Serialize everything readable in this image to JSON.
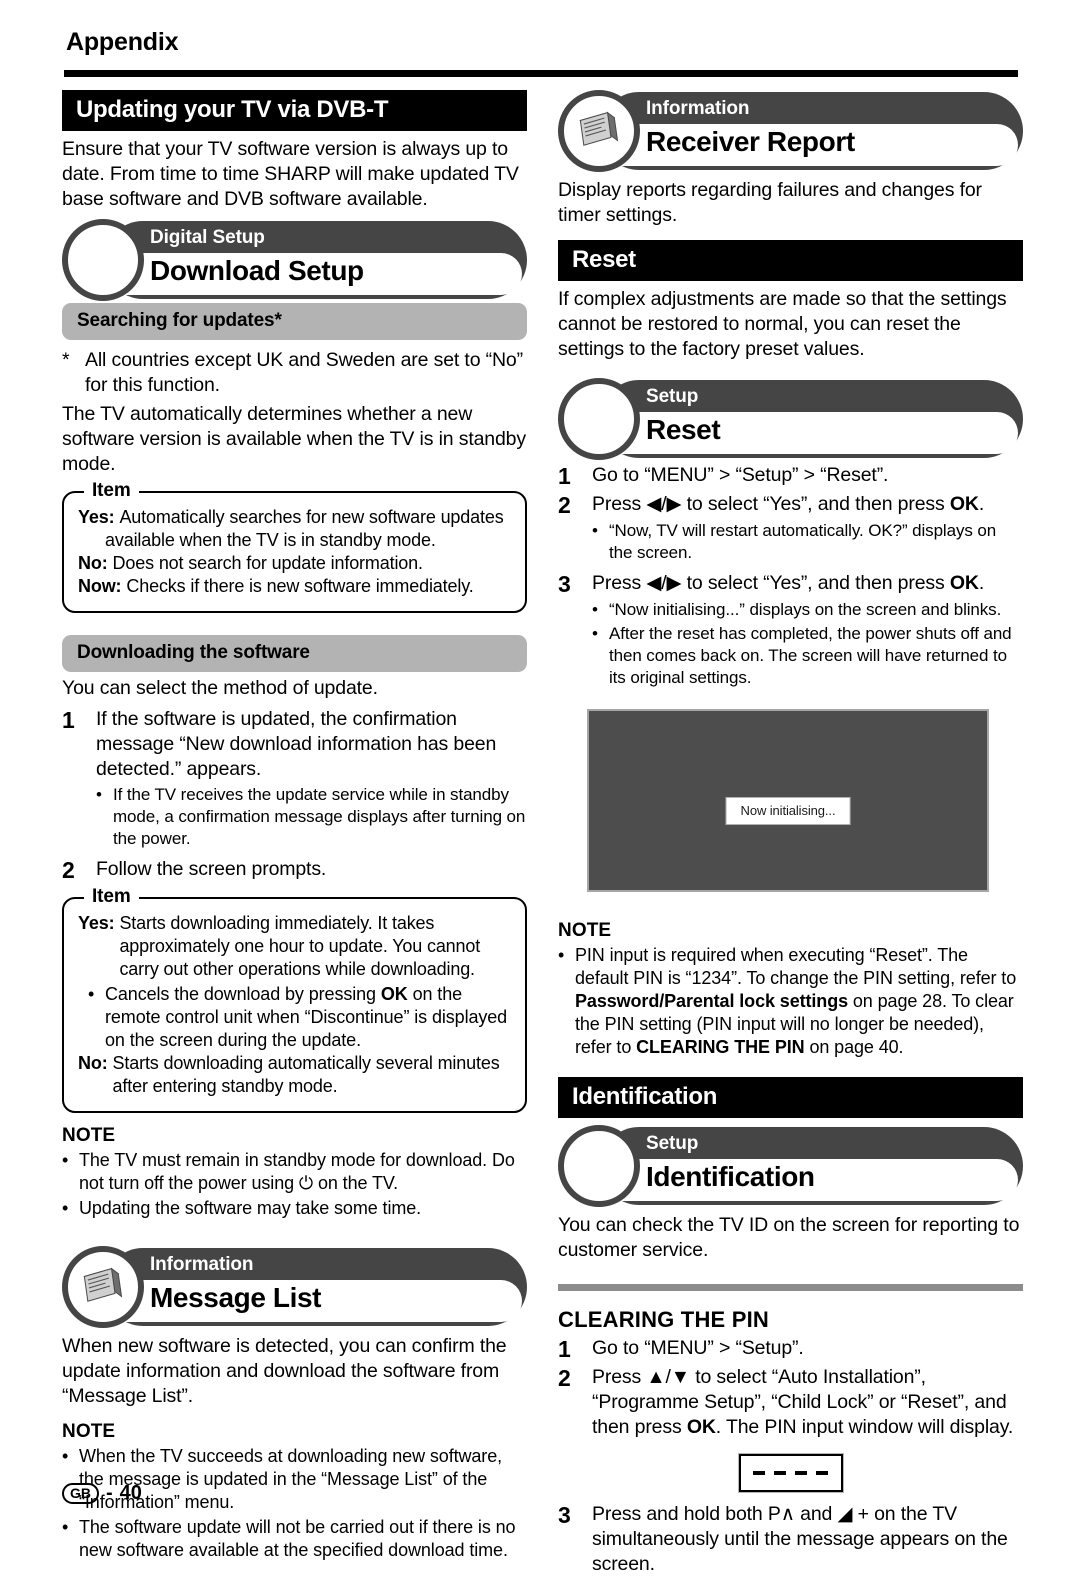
{
  "page": {
    "section_label": "Appendix",
    "footer_region": "GB",
    "footer_sep": "-",
    "footer_page": "40"
  },
  "left": {
    "dvbt": {
      "heading": "Updating your TV via DVB-T",
      "intro": "Ensure that your TV software version is always up to date. From time to time SHARP will make updated TV base software and DVB software available.",
      "banner": {
        "category": "Digital Setup",
        "title": "Download Setup",
        "icon": "circle-icon"
      }
    },
    "searching": {
      "subheading": "Searching for updates*",
      "footnote_mark": "*",
      "footnote": "All countries except UK and Sweden are set to “No” for this function.",
      "paragraph": "The TV automatically determines whether a new software version is available when the TV is in standby mode.",
      "item_box": {
        "label": "Item",
        "rows": [
          {
            "key": "Yes:",
            "value": "Automatically searches for new software updates"
          },
          {
            "key": "",
            "value": "available when the TV is in standby mode.",
            "continuation": true
          },
          {
            "key": "No:",
            "value": "Does not search for update information."
          },
          {
            "key": "Now:",
            "value": "Checks if there is new software immediately."
          }
        ]
      }
    },
    "downloading": {
      "subheading": "Downloading the software",
      "intro": "You can select the method of update.",
      "steps": [
        {
          "num": "1",
          "text": "If the software is updated, the confirmation message “New download information has been detected.” appears."
        },
        {
          "num": "2",
          "text": "Follow the screen prompts."
        }
      ],
      "step1_bullet": "If the TV receives the update service while in standby mode, a confirmation message displays after turning on the power.",
      "item_box": {
        "label": "Item",
        "yes_key": "Yes:",
        "yes_value": "Starts downloading immediately. It takes approximately one hour to update. You cannot carry out other operations while downloading.",
        "bullet": "Cancels the download by pressing OK on the remote control unit when “Discontinue” is displayed on the screen during the update.",
        "bullet_bold": "OK",
        "no_key": "No:",
        "no_value": "Starts downloading automatically several minutes after entering standby mode."
      },
      "note_heading": "NOTE",
      "notes": [
        "The TV must remain in standby mode for download. Do not turn off the power using ⏻ on the TV.",
        "Updating the software may take some time."
      ]
    },
    "message_list": {
      "banner": {
        "category": "Information",
        "title": "Message List",
        "icon": "documents-icon"
      },
      "paragraph": "When new software is detected, you can confirm the update information and download the software from “Message List”.",
      "note_heading": "NOTE",
      "notes": [
        "When the TV succeeds at downloading new software, the message is updated in the “Message List” of the “Information” menu.",
        "The software update will not be carried out if there is no new software available at the specified download time."
      ]
    }
  },
  "right": {
    "receiver_report": {
      "banner": {
        "category": "Information",
        "title": "Receiver Report",
        "icon": "documents-icon"
      },
      "paragraph": "Display reports regarding failures and changes for timer settings."
    },
    "reset": {
      "heading": "Reset",
      "paragraph": "If complex adjustments are made so that the settings cannot be restored to normal, you can reset the settings to the factory preset values.",
      "banner": {
        "category": "Setup",
        "title": "Reset",
        "icon": "circle-icon"
      },
      "steps": [
        {
          "num": "1",
          "pre": "Go to “MENU” > “Setup” > “Reset”.",
          "bold": "",
          "post": ""
        },
        {
          "num": "2",
          "pre": "Press ◀/▶ to select “Yes”, and then press ",
          "bold": "OK",
          "post": "."
        },
        {
          "num": "3",
          "pre": "Press ◀/▶ to select “Yes”, and then press ",
          "bold": "OK",
          "post": "."
        }
      ],
      "step2_bullet": "“Now, TV will restart automatically. OK?” displays on the screen.",
      "step3_bullets": [
        "“Now initialising...” displays on the screen and blinks.",
        "After the reset has completed, the power shuts off and then comes back on. The screen will have returned to its original settings."
      ],
      "tv_screen": {
        "dialog_text": "Now initialising...",
        "bg_color": "#4d4d4d"
      },
      "note_heading": "NOTE",
      "note": {
        "part1": "PIN input is required when executing “Reset”. The default PIN is “1234”. To change the PIN setting, refer to ",
        "bold1": "Password/Parental lock settings",
        "part2": " on page 28. To clear the PIN setting (PIN input will no longer be needed), refer to ",
        "bold2": "CLEARING THE PIN",
        "part3": " on page 40."
      }
    },
    "identification": {
      "heading": "Identification",
      "banner": {
        "category": "Setup",
        "title": "Identification",
        "icon": "circle-icon"
      },
      "paragraph": "You can check the TV ID on the screen for reporting to customer service."
    },
    "clearing_pin": {
      "heading": "CLEARING THE PIN",
      "steps": [
        {
          "num": "1",
          "pre": "Go to “MENU” > “Setup”.",
          "bold": "",
          "post": ""
        },
        {
          "num": "2",
          "pre": "Press ▲/▼ to select “Auto Installation”, “Programme Setup”, “Child Lock” or “Reset”, and then press ",
          "bold": "OK",
          "post": ". The PIN input window will display."
        },
        {
          "num": "3",
          "pre": "Press and hold both P∧ and ◢ + on the TV simultaneously until the message appears on the screen.",
          "bold": "",
          "post": ""
        }
      ],
      "pin_window": {
        "dashes": 4
      }
    }
  }
}
